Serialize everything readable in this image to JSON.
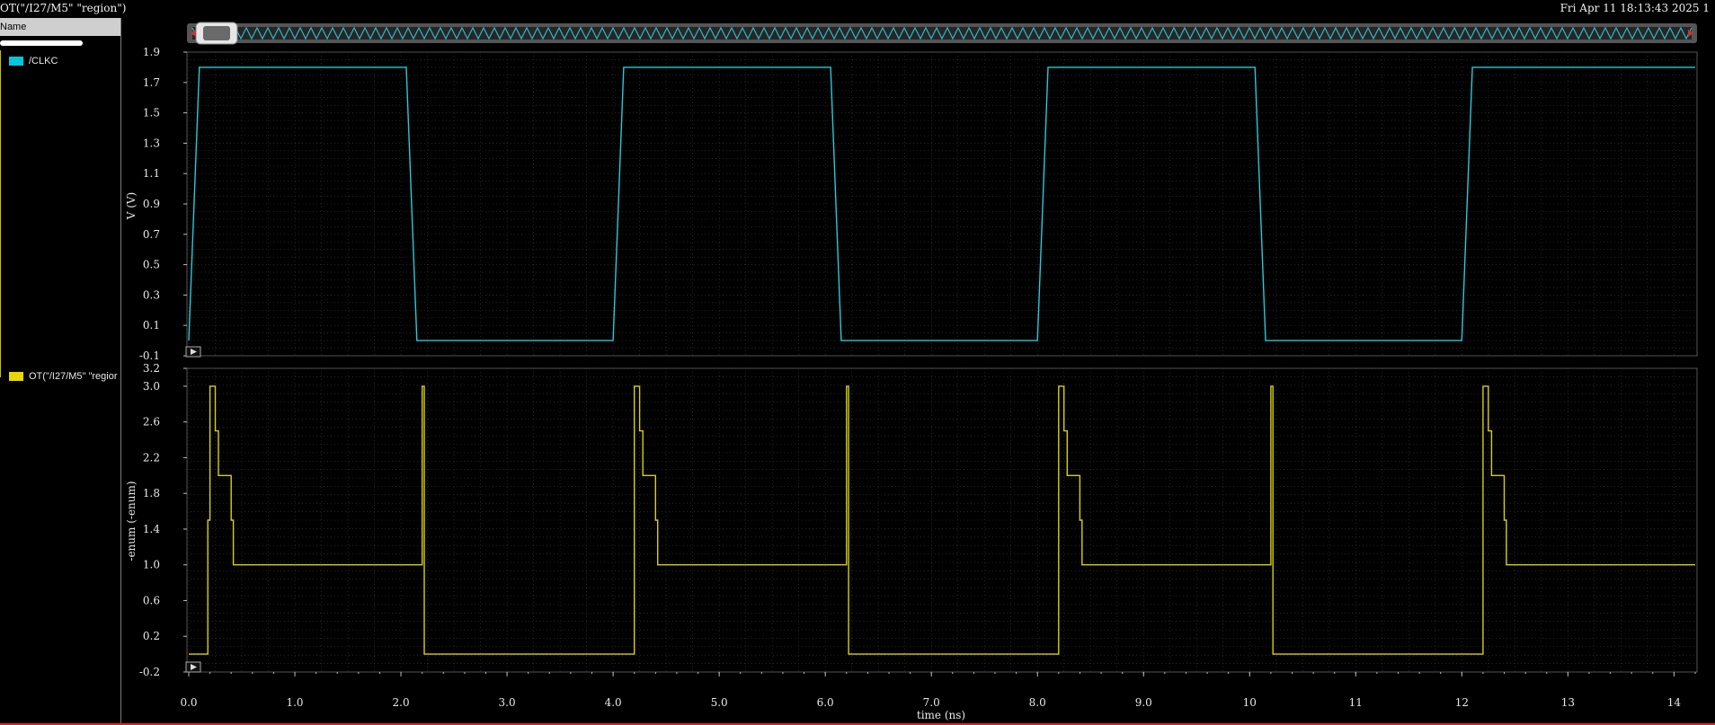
{
  "window": {
    "title_left": "OT(\"/I27/M5\" \"region\")",
    "title_right": "Fri Apr 11 18:13:43 2025  1"
  },
  "sidebar": {
    "header": "Name",
    "items": [
      {
        "label": "/CLKC",
        "color": "#00c8dc"
      },
      {
        "label": "OT(\"/I27/M5\" \"regior",
        "color": "#e8d800"
      }
    ]
  },
  "colors": {
    "clk": "#29c9d8",
    "region": "#d8d010",
    "grid": "#3c3c3c",
    "axis": "#bdbdbd"
  },
  "chart_data": [
    {
      "type": "line",
      "title": "",
      "ylabel": "V (V)",
      "xlabel": "",
      "xlim": [
        0,
        14.2
      ],
      "ylim": [
        -0.1,
        1.9
      ],
      "yticks": [
        "1.9",
        "1.7",
        "1.5",
        "1.3",
        "1.1",
        "0.9",
        "0.7",
        "0.5",
        "0.3",
        "0.1",
        "-0.1"
      ],
      "grid": true,
      "series": [
        {
          "name": "/CLKC",
          "x": [
            0.0,
            0.1,
            2.05,
            2.15,
            4.0,
            4.1,
            6.05,
            6.15,
            8.0,
            8.1,
            10.05,
            10.15,
            12.0,
            12.1,
            14.2
          ],
          "y": [
            0.0,
            1.8,
            1.8,
            0.0,
            0.0,
            1.8,
            1.8,
            0.0,
            0.0,
            1.8,
            1.8,
            0.0,
            0.0,
            1.8,
            1.8
          ]
        }
      ]
    },
    {
      "type": "line",
      "title": "",
      "ylabel": "-enum (-enum)",
      "xlabel": "time (ns)",
      "xlim": [
        0,
        14.2
      ],
      "ylim": [
        -0.2,
        3.2
      ],
      "yticks": [
        "3.2",
        "3.0",
        "2.6",
        "2.2",
        "1.8",
        "1.4",
        "1.0",
        "0.6",
        "0.2",
        "-0.2"
      ],
      "xticks": [
        "0.0",
        "1.0",
        "2.0",
        "3.0",
        "4.0",
        "5.0",
        "6.0",
        "7.0",
        "8.0",
        "9.0",
        "10",
        "11",
        "12",
        "13",
        "14"
      ],
      "grid": true,
      "series": [
        {
          "name": "OT(\"/I27/M5\" \"region\")",
          "x": [
            0.0,
            0.18,
            0.18,
            0.2,
            0.2,
            0.25,
            0.25,
            0.28,
            0.28,
            0.4,
            0.4,
            0.42,
            0.42,
            2.2,
            2.2,
            2.22,
            2.22,
            4.2,
            4.2,
            4.25,
            4.25,
            4.28,
            4.28,
            4.4,
            4.4,
            4.42,
            4.42,
            6.2,
            6.2,
            6.22,
            6.22,
            8.2,
            8.2,
            8.25,
            8.25,
            8.28,
            8.28,
            8.4,
            8.4,
            8.42,
            8.42,
            10.2,
            10.2,
            10.22,
            10.22,
            12.2,
            12.2,
            12.25,
            12.25,
            12.28,
            12.28,
            12.4,
            12.4,
            12.42,
            12.42,
            14.2
          ],
          "y": [
            0.0,
            0.0,
            1.5,
            1.5,
            3.0,
            3.0,
            2.5,
            2.5,
            2.0,
            2.0,
            1.5,
            1.5,
            1.0,
            1.0,
            3.0,
            3.0,
            0.0,
            0.0,
            3.0,
            3.0,
            2.5,
            2.5,
            2.0,
            2.0,
            1.5,
            1.5,
            1.0,
            1.0,
            3.0,
            3.0,
            0.0,
            0.0,
            3.0,
            3.0,
            2.5,
            2.5,
            2.0,
            2.0,
            1.5,
            1.5,
            1.0,
            1.0,
            3.0,
            3.0,
            0.0,
            0.0,
            3.0,
            3.0,
            2.5,
            2.5,
            2.0,
            2.0,
            1.5,
            1.5,
            1.0,
            1.0
          ]
        }
      ]
    }
  ]
}
